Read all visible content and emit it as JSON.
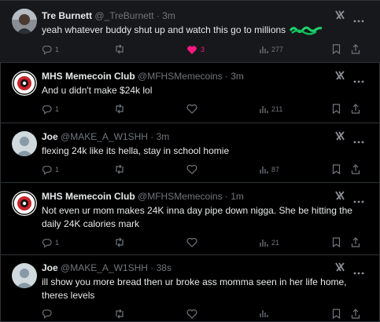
{
  "colors": {
    "background": "#000000",
    "text": "#e7e9ea",
    "muted": "#71767b",
    "like": "#f91880",
    "divider": "#2f3336"
  },
  "posts": [
    {
      "name": "Tre Burnett",
      "handle": "@_TreBurnett",
      "time": "3m",
      "text": "yeah whatever buddy shut up and watch this go to millions",
      "replies": "1",
      "reposts": "",
      "likes": "3",
      "views": "277",
      "avatar": "photo"
    },
    {
      "name": "MHS Memecoin Club",
      "handle": "@MFHSMemecoins",
      "time": "3m",
      "text": "And u didn't make $24k lol",
      "replies": "1",
      "reposts": "",
      "likes": "",
      "views": "211",
      "avatar": "logo"
    },
    {
      "name": "Joe",
      "handle": "@MAKE_A_W1SHH",
      "time": "3m",
      "text": "flexing 24k like its hella, stay in school homie",
      "replies": "1",
      "reposts": "",
      "likes": "",
      "views": "87",
      "avatar": "default"
    },
    {
      "name": "MHS Memecoin Club",
      "handle": "@MFHSMemecoins",
      "time": "1m",
      "text": "Not even ur mom makes 24K inna day pipe down nigga. She be hitting the daily 24K calories mark",
      "replies": "1",
      "reposts": "",
      "likes": "",
      "views": "21",
      "avatar": "logo"
    },
    {
      "name": "Joe",
      "handle": "@MAKE_A_W1SHH",
      "time": "38s",
      "text": "ill show you more bread then ur broke ass momma seen in her life home, theres levels",
      "replies": "",
      "reposts": "",
      "likes": "",
      "views": "",
      "avatar": "default"
    }
  ],
  "separator": "·"
}
